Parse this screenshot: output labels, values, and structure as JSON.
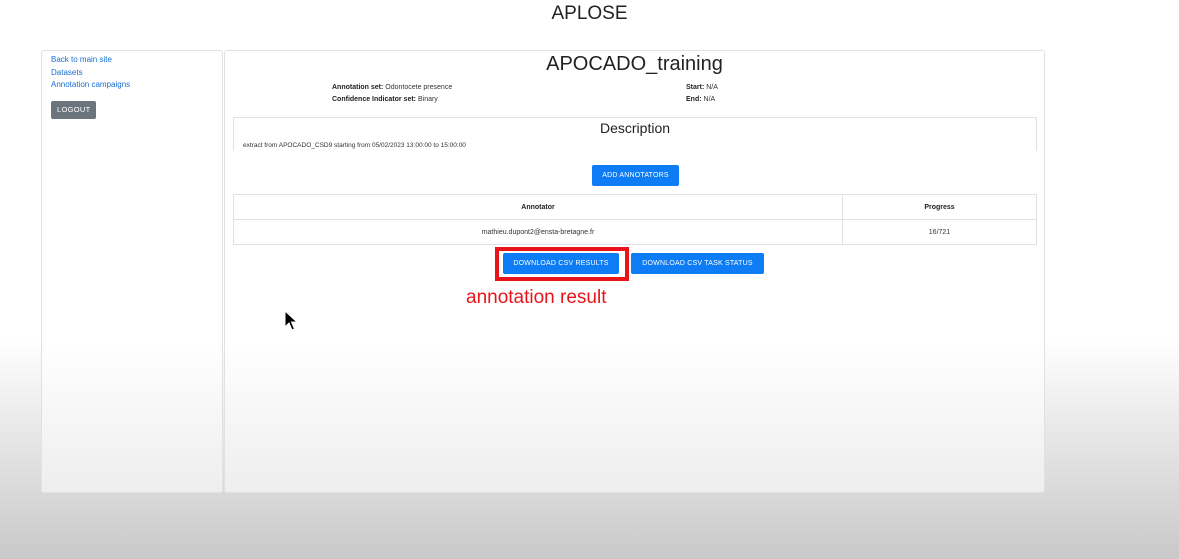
{
  "app": {
    "title": "APLOSE"
  },
  "sidebar": {
    "links": [
      {
        "label": "Back to main site"
      },
      {
        "label": "Datasets"
      },
      {
        "label": "Annotation campaigns"
      }
    ],
    "logout_label": "LOGOUT"
  },
  "campaign": {
    "title": "APOCADO_training",
    "annotation_set_label": "Annotation set:",
    "annotation_set_value": "Odontocete presence",
    "confidence_set_label": "Confidence Indicator set:",
    "confidence_set_value": "Binary",
    "start_label": "Start:",
    "start_value": "N/A",
    "end_label": "End:",
    "end_value": "N/A"
  },
  "description": {
    "title": "Description",
    "text": "extract from APOCADO_CSD9 starting from 05/02/2023 13:00:00 to 15:00:00"
  },
  "add_annotators_label": "ADD ANNOTATORS",
  "table": {
    "headers": [
      "Annotator",
      "Progress"
    ],
    "rows": [
      {
        "annotator": "mathieu.dupont2@ensta-bretagne.fr",
        "progress": "16/721"
      }
    ]
  },
  "downloads": {
    "results_label": "DOWNLOAD CSV RESULTS",
    "task_status_label": "DOWNLOAD CSV TASK STATUS"
  },
  "overlay": {
    "annotation_text": "annotation result",
    "highlight_color": "#e8141a"
  },
  "colors": {
    "primary": "#0d7cf5",
    "secondary": "#6c757d",
    "link": "#1a6fd1"
  }
}
